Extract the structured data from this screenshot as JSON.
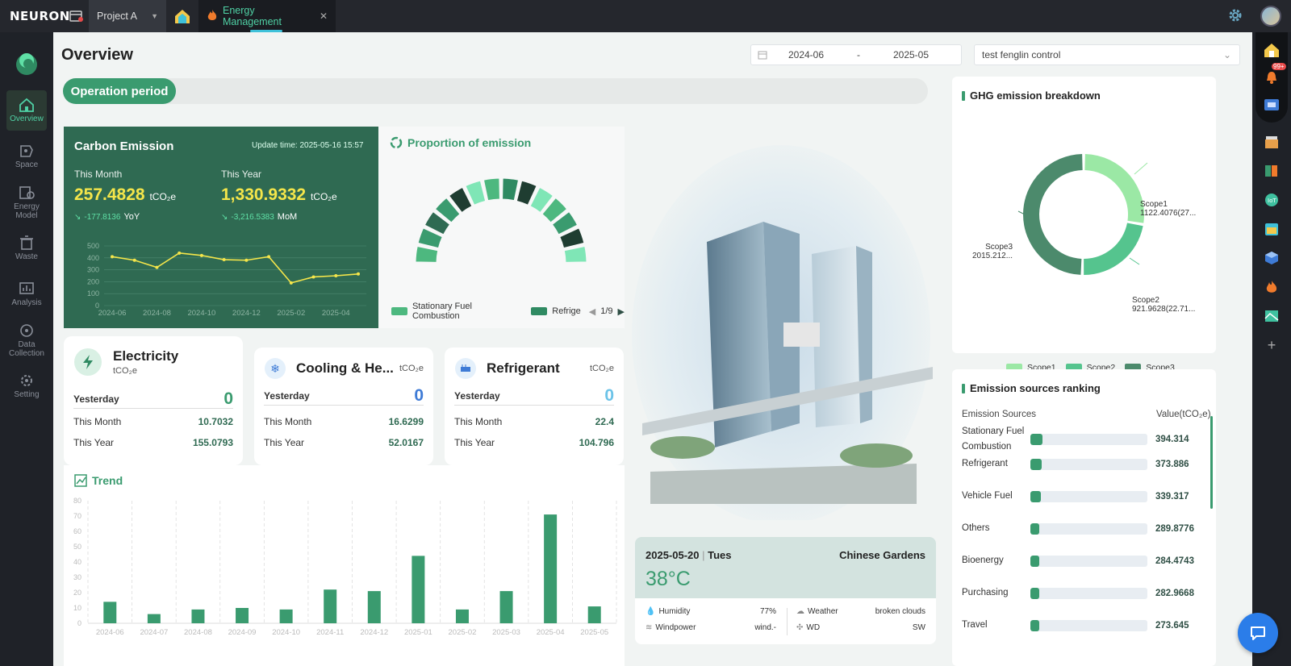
{
  "topbar": {
    "logo": "NEURON",
    "project": "Project A",
    "tab_label": "Energy Management",
    "tab_close": "✕"
  },
  "sidebar": {
    "items": [
      {
        "label": "Overview",
        "icon": "home-icon",
        "active": true
      },
      {
        "label": "Space",
        "icon": "space-icon"
      },
      {
        "label": "Energy Model",
        "icon": "energy-model-icon"
      },
      {
        "label": "Waste",
        "icon": "waste-icon"
      },
      {
        "label": "Analysis",
        "icon": "analysis-icon"
      },
      {
        "label": "Data Collection",
        "icon": "data-collection-icon"
      },
      {
        "label": "Setting",
        "icon": "setting-icon"
      }
    ]
  },
  "rightbar": {
    "badge": "99+"
  },
  "header": {
    "title": "Overview",
    "date_start": "2024-06",
    "date_sep": "-",
    "date_end": "2025-05",
    "select_value": "test fenglin control"
  },
  "operation_period": "Operation period",
  "carbon": {
    "title": "Carbon Emission",
    "update_label": "Update time:",
    "update_time": "2025-05-16 15:57",
    "month_label": "This Month",
    "month_value": "257.4828",
    "unit": "tCO₂e",
    "month_change": "-177.8136",
    "month_change_label": "YoY",
    "year_label": "This Year",
    "year_value": "1,330.9332",
    "year_change": "-3,216.5383",
    "year_change_label": "MoM"
  },
  "proportion": {
    "title": "Proportion of emission",
    "legend": [
      "Stationary Fuel Combustion",
      "Refrige"
    ],
    "page": "1/9"
  },
  "cards": [
    {
      "title": "Electricity",
      "unit": "tCO₂e",
      "yesterday_label": "Yesterday",
      "yesterday": "0",
      "month_label": "This Month",
      "month": "10.7032",
      "year_label": "This Year",
      "year": "155.0793"
    },
    {
      "title": "Cooling & He...",
      "unit": "tCO₂e",
      "yesterday_label": "Yesterday",
      "yesterday": "0",
      "month_label": "This Month",
      "month": "16.6299",
      "year_label": "This Year",
      "year": "52.0167"
    },
    {
      "title": "Refrigerant",
      "unit": "tCO₂e",
      "yesterday_label": "Yesterday",
      "yesterday": "0",
      "month_label": "This Month",
      "month": "22.4",
      "year_label": "This Year",
      "year": "104.796"
    }
  ],
  "trend": {
    "title": "Trend"
  },
  "weather": {
    "date": "2025-05-20",
    "day": "Tues",
    "location": "Chinese Gardens",
    "temp": "38°C",
    "humidity_label": "Humidity",
    "humidity": "77%",
    "weather_label": "Weather",
    "weather": "broken clouds",
    "windpower_label": "Windpower",
    "windpower": "wind.-",
    "wd_label": "WD",
    "wd": "SW"
  },
  "ghg": {
    "title": "GHG emission breakdown",
    "legend": [
      "Scope1",
      "Scope2",
      "Scope3"
    ],
    "labels": [
      {
        "name": "Scope1",
        "value": "1122.4076(27..."
      },
      {
        "name": "Scope2",
        "value": "921.9628(22.71..."
      },
      {
        "name": "Scope3",
        "value": "2015.212..."
      }
    ]
  },
  "ranking": {
    "title": "Emission sources ranking",
    "col_source": "Emission Sources",
    "col_value": "Value(tCO₂e)",
    "rows": [
      {
        "name": "Stationary Fuel Combustion",
        "value": "394.314"
      },
      {
        "name": "Refrigerant",
        "value": "373.886"
      },
      {
        "name": "Vehicle Fuel",
        "value": "339.317"
      },
      {
        "name": "Others",
        "value": "289.8776"
      },
      {
        "name": "Bioenergy",
        "value": "284.4743"
      },
      {
        "name": "Purchasing",
        "value": "282.9668"
      },
      {
        "name": "Travel",
        "value": "273.645"
      }
    ]
  },
  "colors": {
    "brand": "#3a9b6f",
    "carbon_bg": "#2f6a52",
    "highlight": "#f5e64a",
    "scope1": "#9be8a5",
    "scope2": "#55c48e",
    "scope3": "#4c8a6c"
  },
  "chart_data": [
    {
      "type": "line",
      "x": [
        "2024-06",
        "2024-07",
        "2024-08",
        "2024-09",
        "2024-10",
        "2024-11",
        "2024-12",
        "2025-01",
        "2025-02",
        "2025-03",
        "2025-04",
        "2025-05"
      ],
      "x_ticks": [
        "2024-06",
        "2024-08",
        "2024-10",
        "2024-12",
        "2025-02",
        "2025-04"
      ],
      "values": [
        410,
        380,
        320,
        440,
        420,
        385,
        380,
        410,
        190,
        240,
        250,
        265
      ],
      "ylim": [
        0,
        500
      ],
      "y_ticks": [
        0,
        100,
        200,
        300,
        400,
        500
      ]
    },
    {
      "type": "bar",
      "categories": [
        "2024-06",
        "2024-07",
        "2024-08",
        "2024-09",
        "2024-10",
        "2024-11",
        "2024-12",
        "2025-01",
        "2025-02",
        "2025-03",
        "2025-04",
        "2025-05"
      ],
      "values": [
        14,
        6,
        9,
        10,
        9,
        22,
        21,
        44,
        9,
        21,
        71,
        11
      ],
      "ylim": [
        0,
        80
      ],
      "y_ticks": [
        0,
        10,
        20,
        30,
        40,
        50,
        60,
        70,
        80
      ]
    },
    {
      "type": "pie",
      "categories": [
        "Scope1",
        "Scope2",
        "Scope3"
      ],
      "values": [
        1122.4076,
        921.9628,
        2015.212
      ]
    }
  ]
}
